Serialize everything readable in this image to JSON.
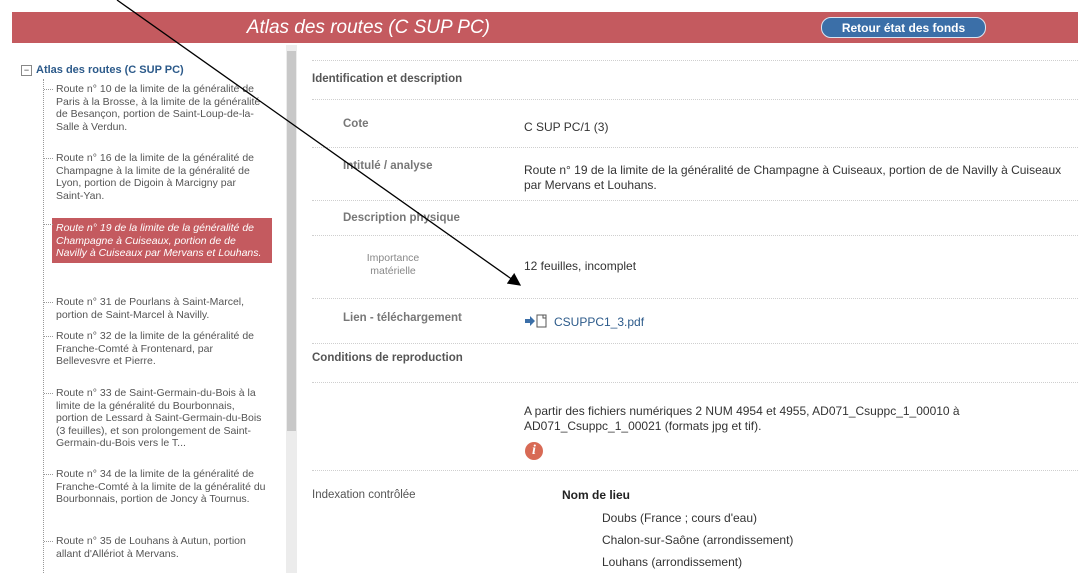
{
  "header": {
    "title": "Atlas des routes (C SUP PC)",
    "button_label": "Retour état des fonds"
  },
  "tree": {
    "root_label": "Atlas des routes (C SUP PC)",
    "items": [
      {
        "label": "Route n° 10 de la limite de la généralité de Paris à la Brosse, à la limite de la généralité de Besançon, portion de Saint-Loup-de-la-Salle à Verdun."
      },
      {
        "label": "Route n° 16 de la limite de la généralité de Champagne à la limite de la généralité de Lyon, portion de Digoin à Marcigny par Saint-Yan."
      },
      {
        "label": "Route n° 19 de la limite de la généralité de Champagne à Cuiseaux, portion de de Navilly à Cuiseaux par Mervans et Louhans."
      },
      {
        "label": "Route n° 31 de Pourlans à Saint-Marcel, portion de Saint-Marcel à Navilly."
      },
      {
        "label": "Route n° 32 de la limite de la généralité de Franche-Comté à Frontenard, par Bellevesvre et Pierre."
      },
      {
        "label": "Route n° 33 de Saint-Germain-du-Bois à la limite de la généralité du Bourbonnais, portion de Lessard à Saint-Germain-du-Bois (3 feuilles), et son prolongement de Saint-Germain-du-Bois vers le T..."
      },
      {
        "label": "Route n° 34 de la limite de la généralité de Franche-Comté à la limite de la généralité du Bourbonnais, portion de Joncy à Tournus."
      },
      {
        "label": "Route n° 35 de Louhans à Autun, portion allant d'Allériot à Mervans."
      }
    ]
  },
  "detail": {
    "section_identification": "Identification et description",
    "cote_label": "Cote",
    "cote_value": "C SUP PC/1 (3)",
    "intitule_label": "Intitulé / analyse",
    "intitule_value": "Route n° 19 de la limite de la généralité de Champagne à Cuiseaux, portion de de Navilly à Cuiseaux par Mervans et Louhans.",
    "description_label": "Description physique",
    "importance_label": "Importance matérielle",
    "importance_value": "12 feuilles, incomplet",
    "lien_label": "Lien - téléchargement",
    "lien_value": "CSUPPC1_3.pdf",
    "section_conditions": "Conditions de reproduction",
    "conditions_value": "A partir des fichiers numériques 2 NUM 4954 et 4955, AD071_Csuppc_1_00010 à AD071_Csuppc_1_00021 (formats jpg et tif).",
    "info_icon_glyph": "i"
  },
  "indexation": {
    "label": "Indexation contrôlée",
    "heading": "Nom de lieu",
    "items": [
      "Doubs (France ; cours d'eau)",
      "Chalon-sur-Saône (arrondissement)",
      "Louhans (arrondissement)"
    ]
  },
  "colors": {
    "header_bg": "#c45a5f",
    "button_bg": "#3b6fa8",
    "selected_item_bg": "#c45a5f",
    "link": "#2c5a8a"
  },
  "icons": [
    "collapse-minus-icon",
    "download-arrow-icon",
    "document-icon",
    "info-icon"
  ]
}
